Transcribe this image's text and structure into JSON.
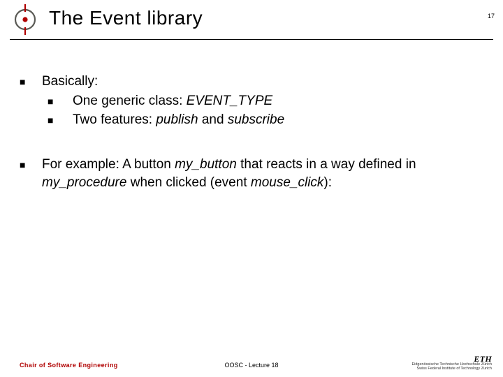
{
  "header": {
    "title": "The Event library",
    "page_number": "17"
  },
  "content": {
    "items": [
      {
        "text": "Basically:",
        "sub": [
          {
            "prefix": "One generic class: ",
            "em": "EVENT_TYPE",
            "suffix": ""
          },
          {
            "prefix": "Two features: ",
            "em": "publish",
            "mid": " and ",
            "em2": "subscribe",
            "suffix": ""
          }
        ]
      },
      {
        "prefix": "For example: A button ",
        "em": "my_button",
        "mid": " that reacts in a way defined in ",
        "em2": "my_procedure",
        "mid2": " when clicked (event ",
        "em3": "mouse_click",
        "suffix": "):"
      }
    ]
  },
  "footer": {
    "left": "Chair of Software Engineering",
    "center": "OOSC - Lecture 18",
    "eth_main": "ETH",
    "eth_line1": "Eidgenössische Technische Hochschule Zürich",
    "eth_line2": "Swiss Federal Institute of Technology Zurich"
  }
}
